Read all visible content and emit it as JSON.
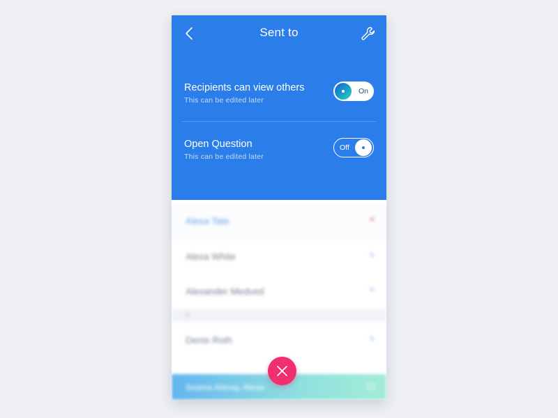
{
  "header": {
    "title": "Sent to",
    "back_icon": "chevron-left-icon",
    "settings_icon": "wrench-icon"
  },
  "settings": [
    {
      "label": "Recipients can view others",
      "sub": "This can be edited later",
      "state_label": "On",
      "on": true
    },
    {
      "label": "Open Question",
      "sub": "This can be edited later",
      "state_label": "Off",
      "on": false
    }
  ],
  "recipients": {
    "rows": [
      {
        "name": "Alexa Tate",
        "action": "×",
        "selected": true
      },
      {
        "name": "Alexa White",
        "action": "+",
        "selected": false
      },
      {
        "name": "Alexander Medved",
        "action": "+",
        "selected": false
      },
      {
        "name": "Denis Roth",
        "action": "+",
        "selected": false
      }
    ],
    "section_letter": "D"
  },
  "footer": {
    "selected_names": "Seama Alenay, Alexa",
    "count": "12"
  },
  "fab": {
    "icon": "close-icon"
  },
  "colors": {
    "brand_blue": "#2b7de9",
    "accent_pink": "#ef2f6e",
    "background": "#eef0f3"
  }
}
